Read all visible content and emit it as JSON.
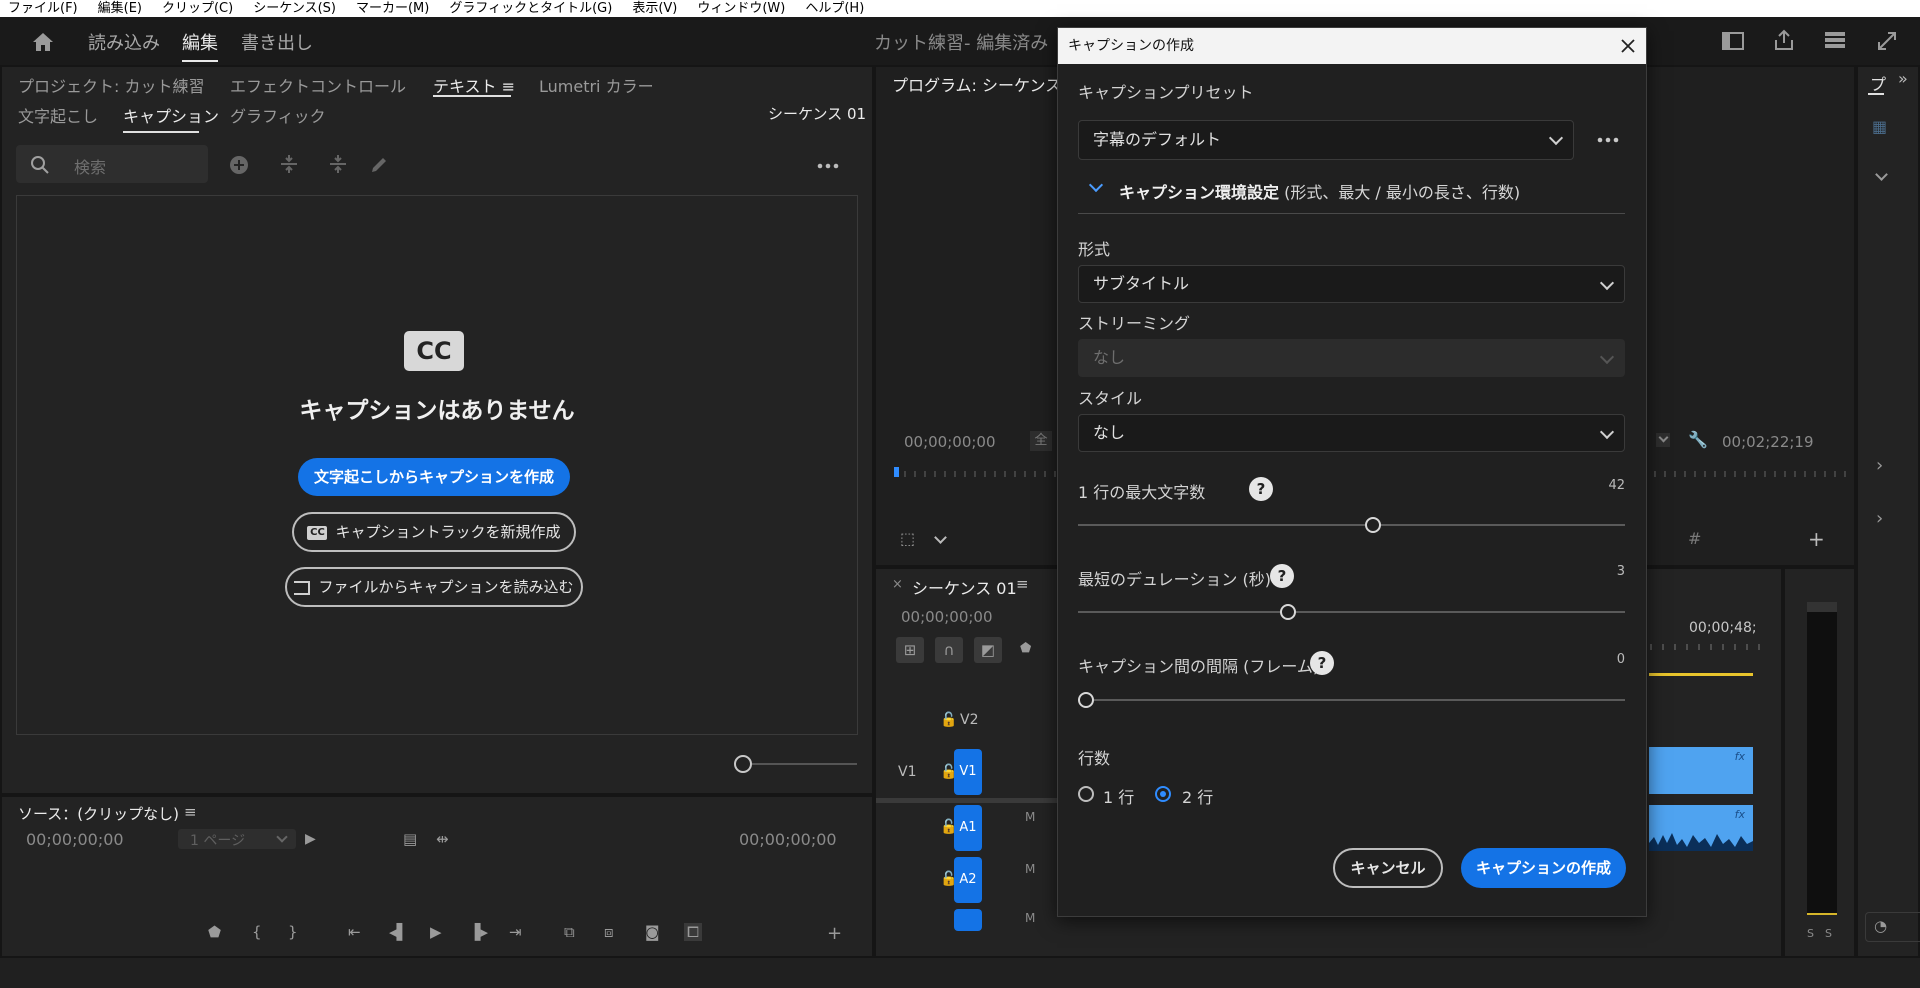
{
  "menubar": [
    "ファイル(F)",
    "編集(E)",
    "クリップ(C)",
    "シーケンス(S)",
    "マーカー(M)",
    "グラフィックとタイトル(G)",
    "表示(V)",
    "ウィンドウ(W)",
    "ヘルプ(H)"
  ],
  "topbar": {
    "tabs": [
      "読み込み",
      "編集",
      "書き出し"
    ],
    "active_tab": "編集",
    "project_title": "カット練習- 編集済み"
  },
  "left_panel": {
    "tabs": [
      "プロジェクト: カット練習",
      "エフェクトコントロール",
      "テキスト ≡",
      "Lumetri カラー"
    ],
    "subtabs": [
      "文字起こし",
      "キャプション",
      "グラフィック"
    ],
    "sequence_label": "シーケンス 01",
    "search_placeholder": "検索",
    "cc_badge": "CC",
    "empty_title": "キャプションはありません",
    "btn_create_from_transcript": "文字起こしからキャプションを作成",
    "btn_new_track": "キャプショントラックを新規作成",
    "btn_import_file": "ファイルからキャプションを読み込む"
  },
  "source_panel": {
    "title": "ソース：(クリップなし)",
    "menu_glyph": "≡",
    "timecode_left": "00;00;00;00",
    "page_select": "1 ページ",
    "timecode_right": "00;00;00;00"
  },
  "program_panel": {
    "title": "プログラム: シーケンス",
    "timecode_left": "00;00;00;00",
    "fit_label": "全",
    "timecode_right": "00;02;22;19"
  },
  "timeline": {
    "sequence_tab": "シーケンス 01",
    "menu_glyph": "≡",
    "timecode": "00;00;00;00",
    "ruler_time": "00;00;48;",
    "source_patch": "V1",
    "tracks": [
      "V2",
      "V1",
      "A1",
      "A2"
    ],
    "m_label": "M",
    "fx_label": "fx",
    "meter_labels": [
      "S",
      "S"
    ]
  },
  "right_panel": {
    "tab": "プ"
  },
  "dialog": {
    "title": "キャプションの作成",
    "preset_label": "キャプションプリセット",
    "preset_value": "字幕のデフォルト",
    "section_bold": "キャプション環境設定",
    "section_rest": " (形式、最大 / 最小の長さ、行数)",
    "format_label": "形式",
    "format_value": "サブタイトル",
    "streaming_label": "ストリーミング",
    "streaming_value": "なし",
    "style_label": "スタイル",
    "style_value": "なし",
    "max_chars_label": "1 行の最大文字数",
    "max_chars_value": "42",
    "max_chars_fraction": 0.54,
    "min_duration_label": "最短のデュレーション (秒)",
    "min_duration_value": "3",
    "min_duration_fraction": 0.38,
    "gap_label": "キャプション間の間隔 (フレーム)",
    "gap_value": "0",
    "gap_fraction": 0.0,
    "lines_label": "行数",
    "line_options": [
      "1 行",
      "2 行"
    ],
    "selected_lines": "2 行",
    "help_glyph": "?",
    "cancel_label": "キャンセル",
    "create_label": "キャプションの作成"
  },
  "colors": {
    "accent": "#1473e6",
    "panel_bg": "#232323",
    "dialog_bg": "#202020",
    "clip_blue": "#4fa3f0"
  }
}
